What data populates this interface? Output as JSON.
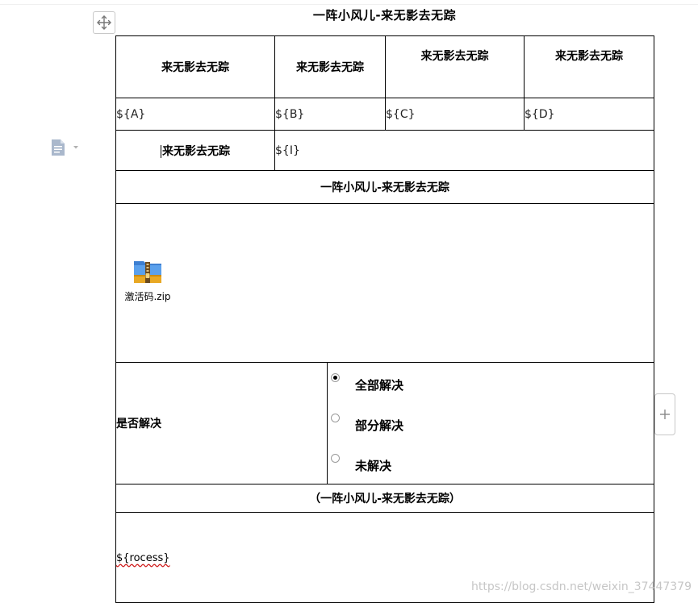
{
  "title": "一阵小风儿-来无影去无踪",
  "header_row": [
    "来无影去无踪",
    "来无影去无踪",
    "来无影去无踪",
    "来无影去无踪"
  ],
  "placeholder_row": [
    "${A}",
    "${B}",
    "${C}",
    "${D}"
  ],
  "row3": {
    "label": "来无影去无踪",
    "value": "${I}"
  },
  "section_title": "一阵小风儿-来无影去无踪",
  "attachment": {
    "file_name": "激活码.zip",
    "icon": "zip-archive-icon"
  },
  "resolve": {
    "label": "是否解决",
    "options": [
      {
        "label": "全部解决",
        "checked": true
      },
      {
        "label": "部分解决",
        "checked": false
      },
      {
        "label": "未解决",
        "checked": false
      }
    ]
  },
  "footer_title": "（一阵小风儿-来无影去无踪）",
  "process_placeholder": "${rocess}",
  "watermark": "https://blog.csdn.net/weixin_37447379",
  "icons": {
    "move": "move-arrows-icon",
    "doc": "document-icon",
    "add": "plus-icon"
  }
}
